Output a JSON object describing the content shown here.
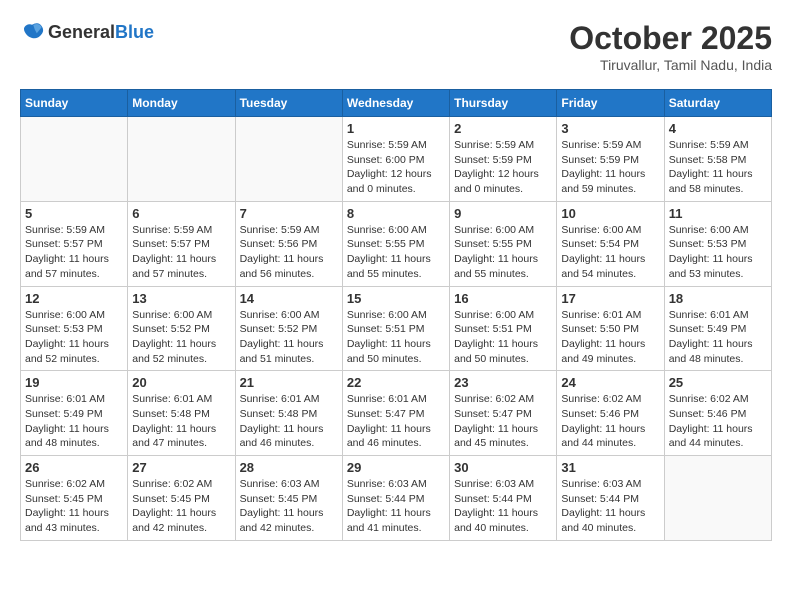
{
  "header": {
    "logo_general": "General",
    "logo_blue": "Blue",
    "month": "October 2025",
    "location": "Tiruvallur, Tamil Nadu, India"
  },
  "days_of_week": [
    "Sunday",
    "Monday",
    "Tuesday",
    "Wednesday",
    "Thursday",
    "Friday",
    "Saturday"
  ],
  "weeks": [
    [
      {
        "day": "",
        "sunrise": "",
        "sunset": "",
        "daylight": ""
      },
      {
        "day": "",
        "sunrise": "",
        "sunset": "",
        "daylight": ""
      },
      {
        "day": "",
        "sunrise": "",
        "sunset": "",
        "daylight": ""
      },
      {
        "day": "1",
        "sunrise": "Sunrise: 5:59 AM",
        "sunset": "Sunset: 6:00 PM",
        "daylight": "Daylight: 12 hours and 0 minutes."
      },
      {
        "day": "2",
        "sunrise": "Sunrise: 5:59 AM",
        "sunset": "Sunset: 5:59 PM",
        "daylight": "Daylight: 12 hours and 0 minutes."
      },
      {
        "day": "3",
        "sunrise": "Sunrise: 5:59 AM",
        "sunset": "Sunset: 5:59 PM",
        "daylight": "Daylight: 11 hours and 59 minutes."
      },
      {
        "day": "4",
        "sunrise": "Sunrise: 5:59 AM",
        "sunset": "Sunset: 5:58 PM",
        "daylight": "Daylight: 11 hours and 58 minutes."
      }
    ],
    [
      {
        "day": "5",
        "sunrise": "Sunrise: 5:59 AM",
        "sunset": "Sunset: 5:57 PM",
        "daylight": "Daylight: 11 hours and 57 minutes."
      },
      {
        "day": "6",
        "sunrise": "Sunrise: 5:59 AM",
        "sunset": "Sunset: 5:57 PM",
        "daylight": "Daylight: 11 hours and 57 minutes."
      },
      {
        "day": "7",
        "sunrise": "Sunrise: 5:59 AM",
        "sunset": "Sunset: 5:56 PM",
        "daylight": "Daylight: 11 hours and 56 minutes."
      },
      {
        "day": "8",
        "sunrise": "Sunrise: 6:00 AM",
        "sunset": "Sunset: 5:55 PM",
        "daylight": "Daylight: 11 hours and 55 minutes."
      },
      {
        "day": "9",
        "sunrise": "Sunrise: 6:00 AM",
        "sunset": "Sunset: 5:55 PM",
        "daylight": "Daylight: 11 hours and 55 minutes."
      },
      {
        "day": "10",
        "sunrise": "Sunrise: 6:00 AM",
        "sunset": "Sunset: 5:54 PM",
        "daylight": "Daylight: 11 hours and 54 minutes."
      },
      {
        "day": "11",
        "sunrise": "Sunrise: 6:00 AM",
        "sunset": "Sunset: 5:53 PM",
        "daylight": "Daylight: 11 hours and 53 minutes."
      }
    ],
    [
      {
        "day": "12",
        "sunrise": "Sunrise: 6:00 AM",
        "sunset": "Sunset: 5:53 PM",
        "daylight": "Daylight: 11 hours and 52 minutes."
      },
      {
        "day": "13",
        "sunrise": "Sunrise: 6:00 AM",
        "sunset": "Sunset: 5:52 PM",
        "daylight": "Daylight: 11 hours and 52 minutes."
      },
      {
        "day": "14",
        "sunrise": "Sunrise: 6:00 AM",
        "sunset": "Sunset: 5:52 PM",
        "daylight": "Daylight: 11 hours and 51 minutes."
      },
      {
        "day": "15",
        "sunrise": "Sunrise: 6:00 AM",
        "sunset": "Sunset: 5:51 PM",
        "daylight": "Daylight: 11 hours and 50 minutes."
      },
      {
        "day": "16",
        "sunrise": "Sunrise: 6:00 AM",
        "sunset": "Sunset: 5:51 PM",
        "daylight": "Daylight: 11 hours and 50 minutes."
      },
      {
        "day": "17",
        "sunrise": "Sunrise: 6:01 AM",
        "sunset": "Sunset: 5:50 PM",
        "daylight": "Daylight: 11 hours and 49 minutes."
      },
      {
        "day": "18",
        "sunrise": "Sunrise: 6:01 AM",
        "sunset": "Sunset: 5:49 PM",
        "daylight": "Daylight: 11 hours and 48 minutes."
      }
    ],
    [
      {
        "day": "19",
        "sunrise": "Sunrise: 6:01 AM",
        "sunset": "Sunset: 5:49 PM",
        "daylight": "Daylight: 11 hours and 48 minutes."
      },
      {
        "day": "20",
        "sunrise": "Sunrise: 6:01 AM",
        "sunset": "Sunset: 5:48 PM",
        "daylight": "Daylight: 11 hours and 47 minutes."
      },
      {
        "day": "21",
        "sunrise": "Sunrise: 6:01 AM",
        "sunset": "Sunset: 5:48 PM",
        "daylight": "Daylight: 11 hours and 46 minutes."
      },
      {
        "day": "22",
        "sunrise": "Sunrise: 6:01 AM",
        "sunset": "Sunset: 5:47 PM",
        "daylight": "Daylight: 11 hours and 46 minutes."
      },
      {
        "day": "23",
        "sunrise": "Sunrise: 6:02 AM",
        "sunset": "Sunset: 5:47 PM",
        "daylight": "Daylight: 11 hours and 45 minutes."
      },
      {
        "day": "24",
        "sunrise": "Sunrise: 6:02 AM",
        "sunset": "Sunset: 5:46 PM",
        "daylight": "Daylight: 11 hours and 44 minutes."
      },
      {
        "day": "25",
        "sunrise": "Sunrise: 6:02 AM",
        "sunset": "Sunset: 5:46 PM",
        "daylight": "Daylight: 11 hours and 44 minutes."
      }
    ],
    [
      {
        "day": "26",
        "sunrise": "Sunrise: 6:02 AM",
        "sunset": "Sunset: 5:45 PM",
        "daylight": "Daylight: 11 hours and 43 minutes."
      },
      {
        "day": "27",
        "sunrise": "Sunrise: 6:02 AM",
        "sunset": "Sunset: 5:45 PM",
        "daylight": "Daylight: 11 hours and 42 minutes."
      },
      {
        "day": "28",
        "sunrise": "Sunrise: 6:03 AM",
        "sunset": "Sunset: 5:45 PM",
        "daylight": "Daylight: 11 hours and 42 minutes."
      },
      {
        "day": "29",
        "sunrise": "Sunrise: 6:03 AM",
        "sunset": "Sunset: 5:44 PM",
        "daylight": "Daylight: 11 hours and 41 minutes."
      },
      {
        "day": "30",
        "sunrise": "Sunrise: 6:03 AM",
        "sunset": "Sunset: 5:44 PM",
        "daylight": "Daylight: 11 hours and 40 minutes."
      },
      {
        "day": "31",
        "sunrise": "Sunrise: 6:03 AM",
        "sunset": "Sunset: 5:44 PM",
        "daylight": "Daylight: 11 hours and 40 minutes."
      },
      {
        "day": "",
        "sunrise": "",
        "sunset": "",
        "daylight": ""
      }
    ]
  ]
}
